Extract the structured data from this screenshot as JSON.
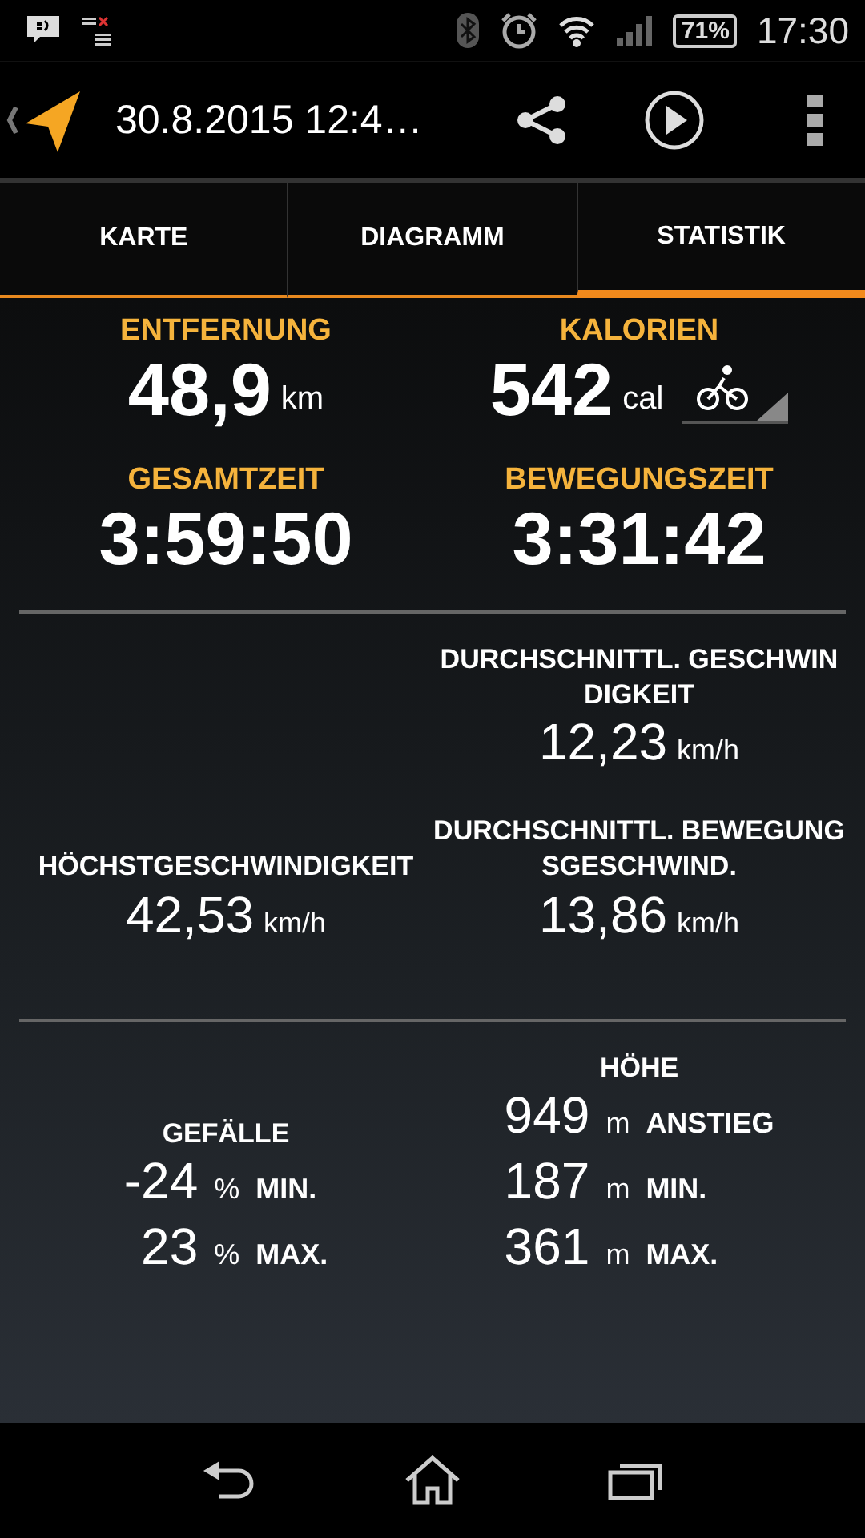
{
  "status_bar": {
    "battery": "71%",
    "time": "17:30"
  },
  "app_bar": {
    "title": "30.8.2015 12:4…"
  },
  "tabs": [
    {
      "label": "KARTE",
      "selected": false
    },
    {
      "label": "DIAGRAMM",
      "selected": false
    },
    {
      "label": "STATISTIK",
      "selected": true
    }
  ],
  "summary": [
    {
      "label": "ENTFERNUNG",
      "value": "48,9",
      "unit": "km"
    },
    {
      "label": "KALORIEN",
      "value": "542",
      "unit": "cal",
      "kind": "activity"
    },
    {
      "label": "GESAMTZEIT",
      "value": "3:59:50"
    },
    {
      "label": "BEWEGUNGSZEIT",
      "value": "3:31:42"
    }
  ],
  "speed_rows": [
    {
      "right": {
        "label": "DURCHSCHNITTL. GESCHWINDIGKEIT",
        "value": "12,23",
        "unit": "km/h"
      }
    },
    {
      "left": {
        "label": "HÖCHSTGESCHWINDIGKEIT",
        "value": "42,53",
        "unit": "km/h"
      },
      "right": {
        "label": "DURCHSCHNITTL. BEWEGUNGSGESCHWIND.",
        "value": "13,86",
        "unit": "km/h"
      }
    }
  ],
  "grade": {
    "title": "GEFÄLLE",
    "rows": [
      {
        "value": "-24",
        "unit": "%",
        "label": "MIN."
      },
      {
        "value": "23",
        "unit": "%",
        "label": "MAX."
      }
    ]
  },
  "elevation": {
    "title": "HÖHE",
    "rows": [
      {
        "value": "949",
        "unit": "m",
        "label": "ANSTIEG"
      },
      {
        "value": "187",
        "unit": "m",
        "label": "MIN."
      },
      {
        "value": "361",
        "unit": "m",
        "label": "MAX."
      }
    ]
  }
}
